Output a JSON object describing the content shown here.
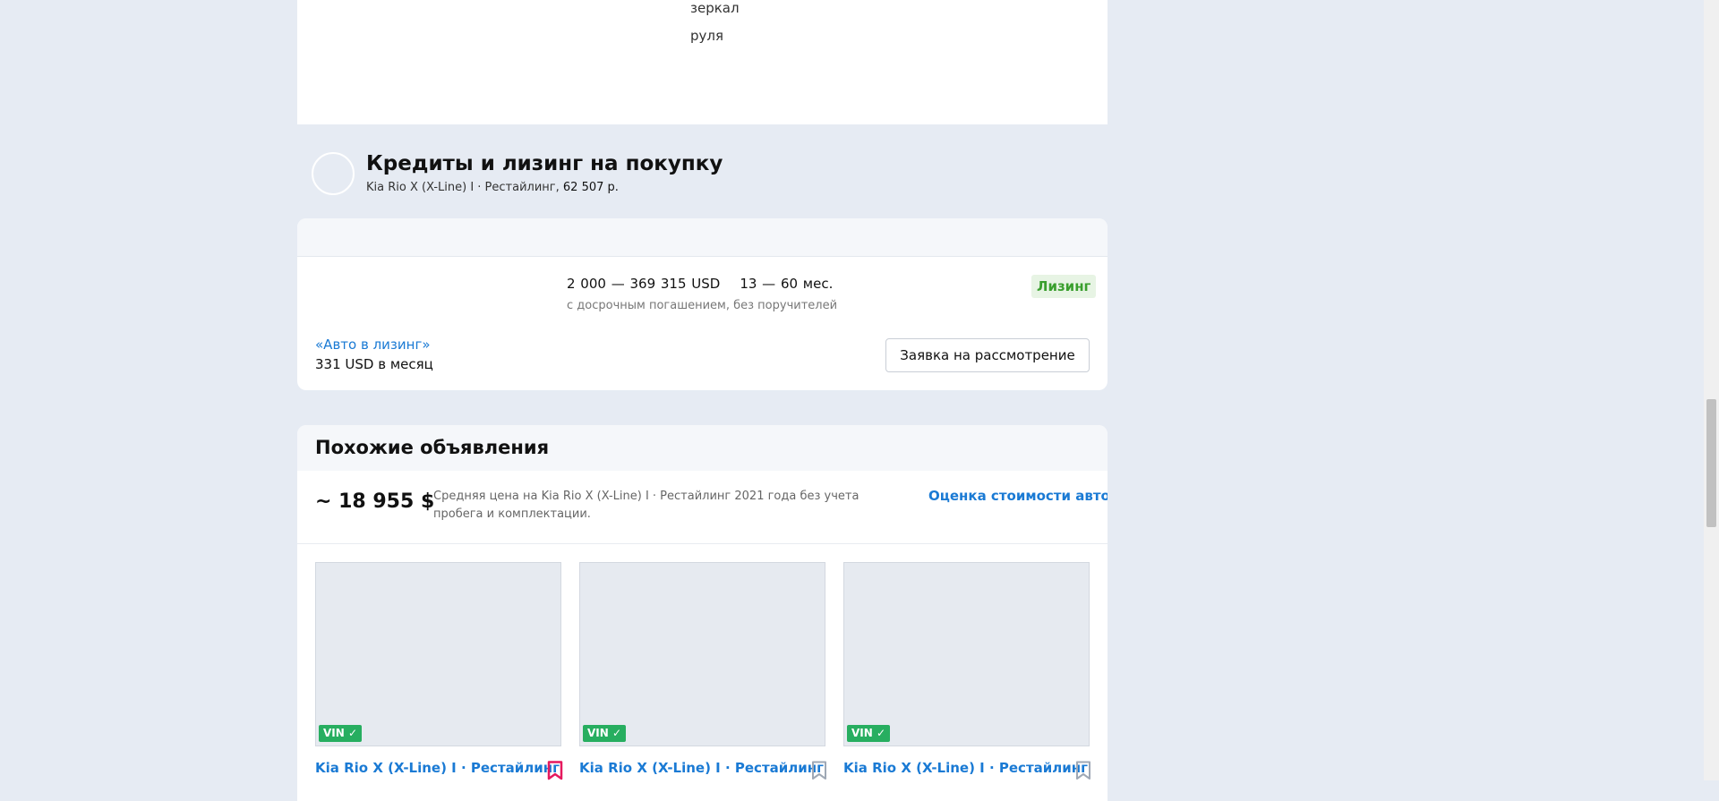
{
  "equipment": {
    "lines": [
      "зеркал",
      "руля"
    ]
  },
  "credit": {
    "title": "Кредиты и лизинг на покупку",
    "subtitle_car": "Kia Rio X (X-Line) I · Рестайлинг, ",
    "subtitle_price": "62 507 р."
  },
  "leasing": {
    "range_amount": "2 000 — 369 315 USD",
    "range_term": "13 — 60 мес.",
    "note": "с досрочным погашением, без поручителей",
    "badge": "Лизинг",
    "product_name": "«Авто в лизинг»",
    "monthly": "331 USD в месяц",
    "apply_button": "Заявка на рассмотрение"
  },
  "similar": {
    "title": "Похожие объявления",
    "avg_price": "~ 18 955 $",
    "avg_description": "Средняя цена на Kia Rio X (X-Line) I · Рестайлинг 2021 года без учета пробега и комплектации.",
    "valuation_link": "Оценка стоимости авто",
    "ads": [
      {
        "title": "Kia Rio X (X-Line) I · Рестайлинг",
        "vin_label": "VIN ✓",
        "bookmark_icon": "bookmark-filled-icon",
        "bookmark_color": "#e5195e"
      },
      {
        "title": "Kia Rio X (X-Line) I · Рестайлинг",
        "vin_label": "VIN ✓",
        "bookmark_icon": "bookmark-outline-icon",
        "bookmark_color": "#9fa8b5"
      },
      {
        "title": "Kia Rio X (X-Line) I · Рестайлинг",
        "vin_label": "VIN ✓",
        "bookmark_icon": "bookmark-outline-icon",
        "bookmark_color": "#9fa8b5"
      }
    ]
  },
  "colors": {
    "link": "#1a7ad4",
    "vin_badge": "#27ae60",
    "leasing_badge_text": "#3a9f2e"
  }
}
